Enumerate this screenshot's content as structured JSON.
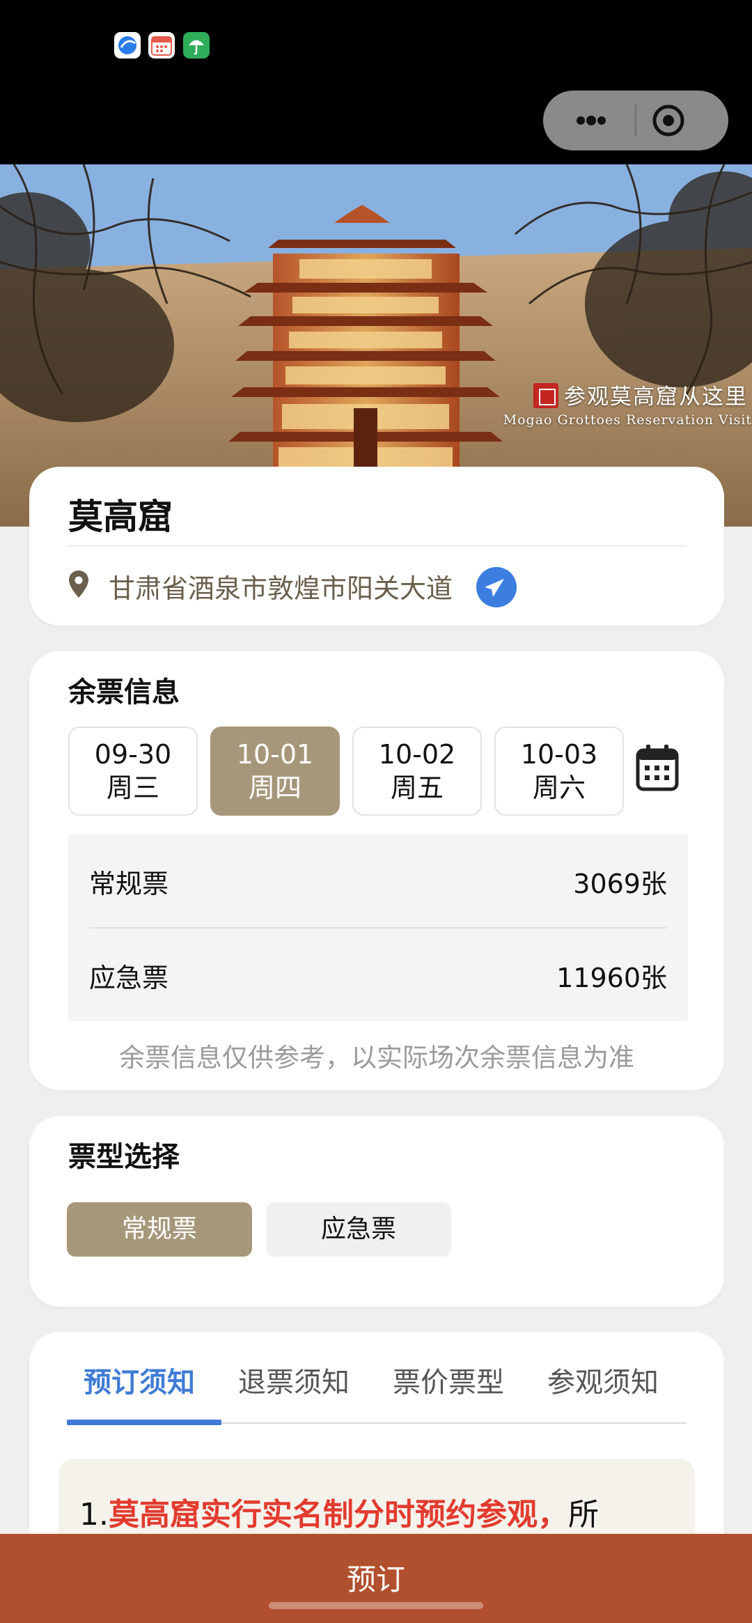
{
  "hero": {
    "caption": "参观莫高窟从这里",
    "caption_sub": "Mogao Grottoes Reservation Visit"
  },
  "site": {
    "name": "莫高窟",
    "address": "甘肃省酒泉市敦煌市阳关大道"
  },
  "ticket_info": {
    "title": "余票信息",
    "dates": [
      {
        "date": "09-30",
        "weekday": "周三",
        "selected": false
      },
      {
        "date": "10-01",
        "weekday": "周四",
        "selected": true
      },
      {
        "date": "10-02",
        "weekday": "周五",
        "selected": false
      },
      {
        "date": "10-03",
        "weekday": "周六",
        "selected": false
      }
    ],
    "rows": [
      {
        "label": "常规票",
        "value": "3069张"
      },
      {
        "label": "应急票",
        "value": "11960张"
      }
    ],
    "note": "余票信息仅供参考，以实际场次余票信息为准"
  },
  "ticket_type": {
    "title": "票型选择",
    "options": [
      {
        "label": "常规票",
        "selected": true
      },
      {
        "label": "应急票",
        "selected": false
      }
    ]
  },
  "notice": {
    "tabs": [
      "预订须知",
      "退票须知",
      "票价票型",
      "参观须知"
    ],
    "active_tab": 0,
    "line_prefix": "1.",
    "line_highlight": "莫高窟实行实名制分时预约参观，",
    "line_rest": "所"
  },
  "book_button": "预订",
  "colors": {
    "accent_gold": "#a7977a",
    "accent_blue": "#3f7bd6",
    "book_bar": "#b1502e",
    "highlight_red": "#e23b2e"
  }
}
